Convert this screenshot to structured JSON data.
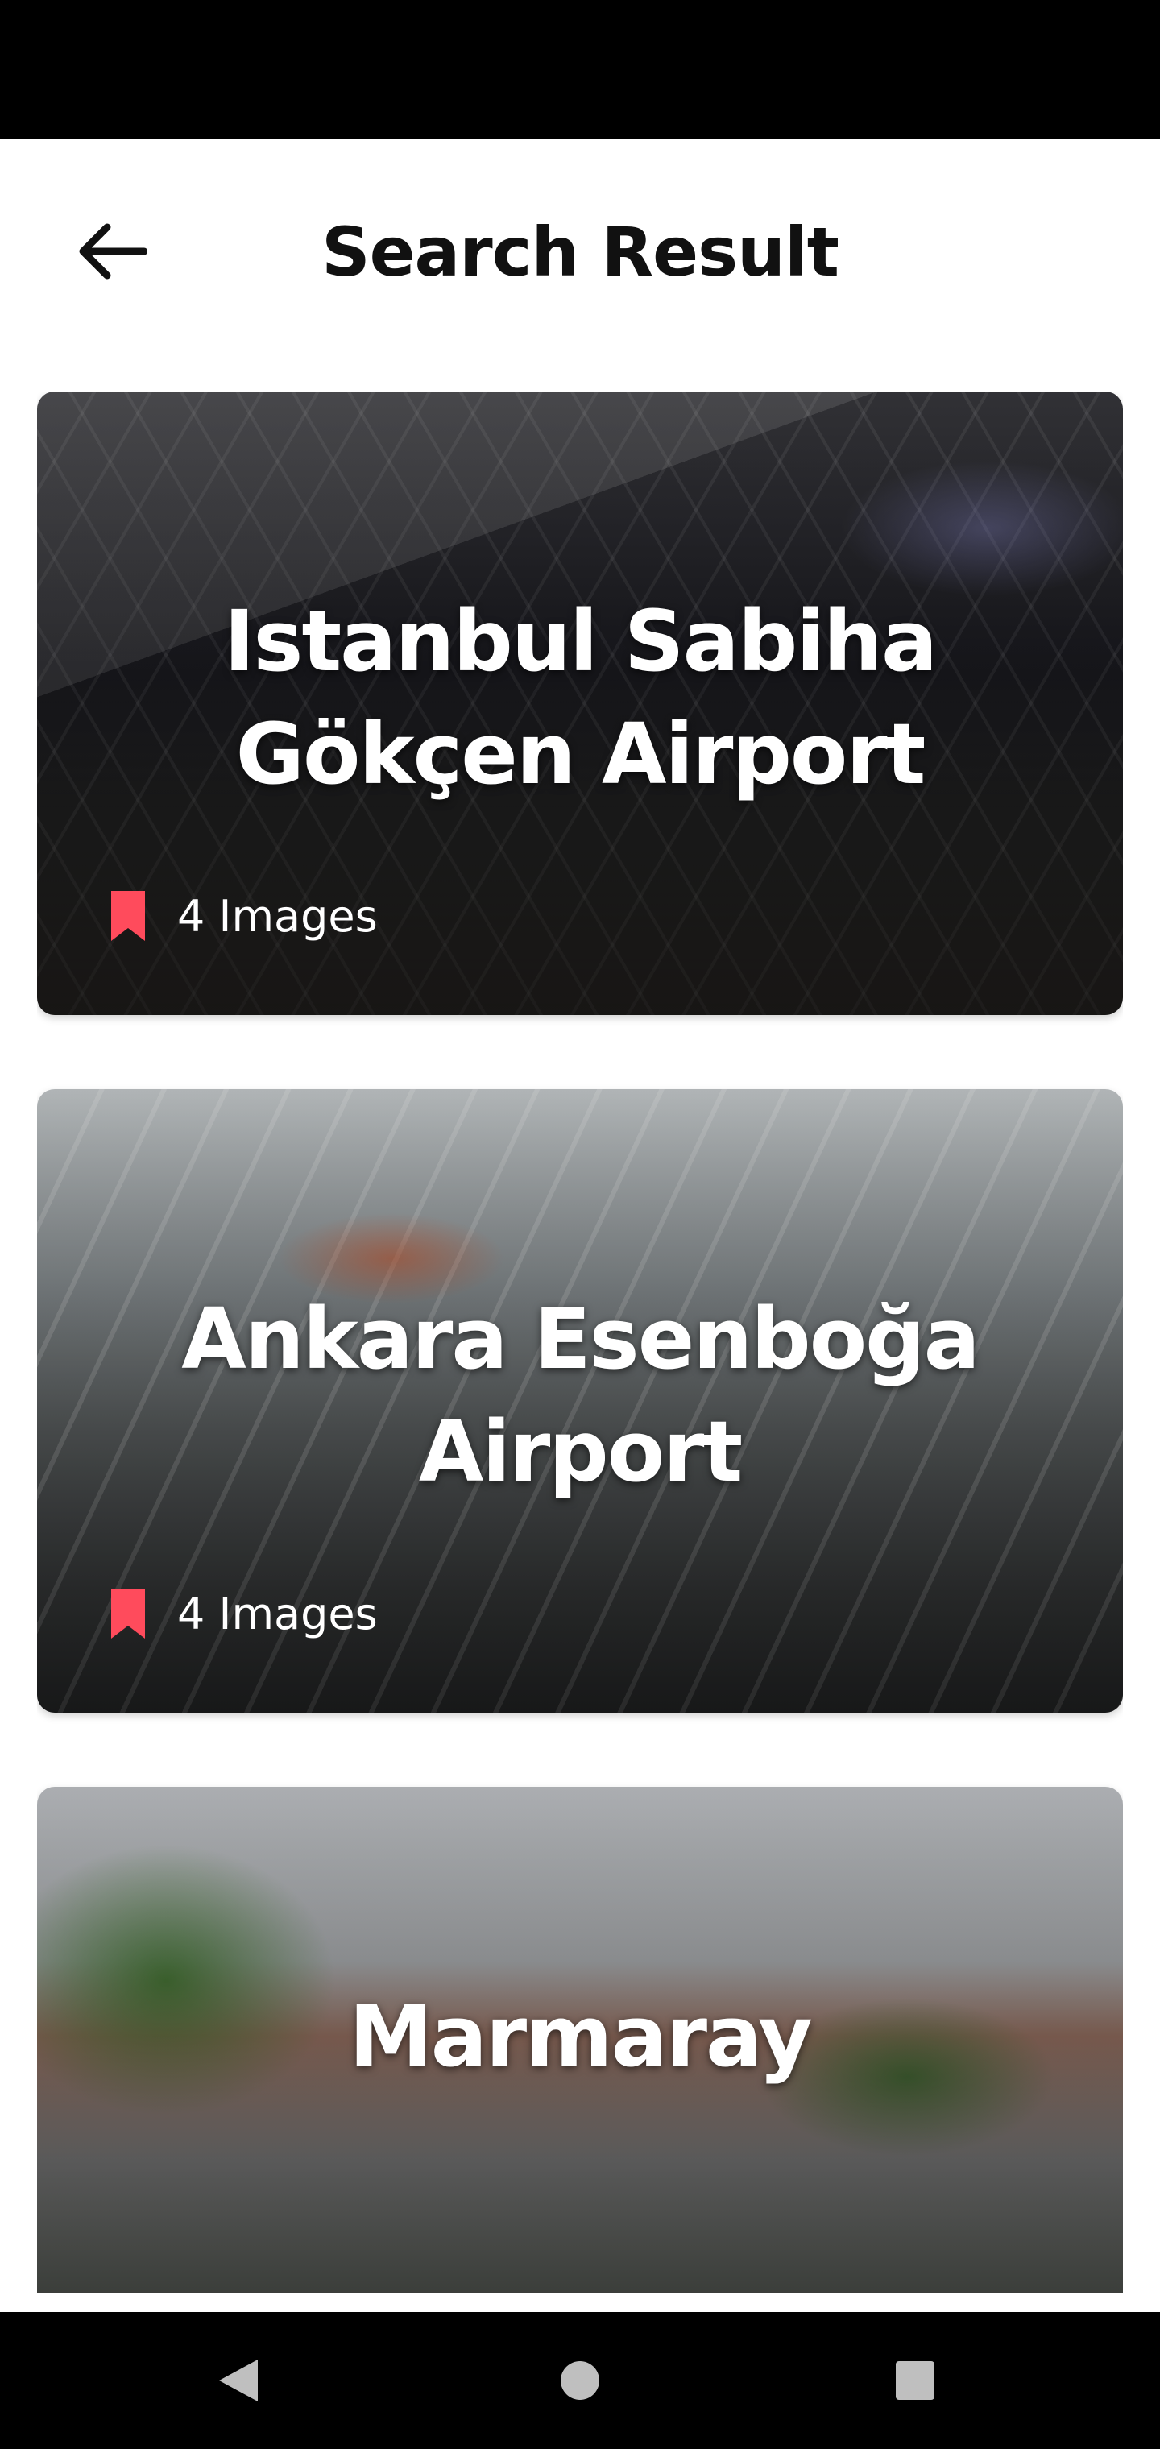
{
  "header": {
    "title": "Search Result"
  },
  "results": [
    {
      "title": "Istanbul Sabiha Gökçen Airport",
      "images_label": "4 Images"
    },
    {
      "title": "Ankara Esenboğa Airport",
      "images_label": "4 Images"
    },
    {
      "title": "Marmaray",
      "images_label": ""
    }
  ],
  "colors": {
    "accent": "#FF4B5C",
    "title": "#111111",
    "background": "#FFFFFF"
  },
  "icons": {
    "back": "arrow-left-icon",
    "bookmark": "bookmark-icon"
  }
}
